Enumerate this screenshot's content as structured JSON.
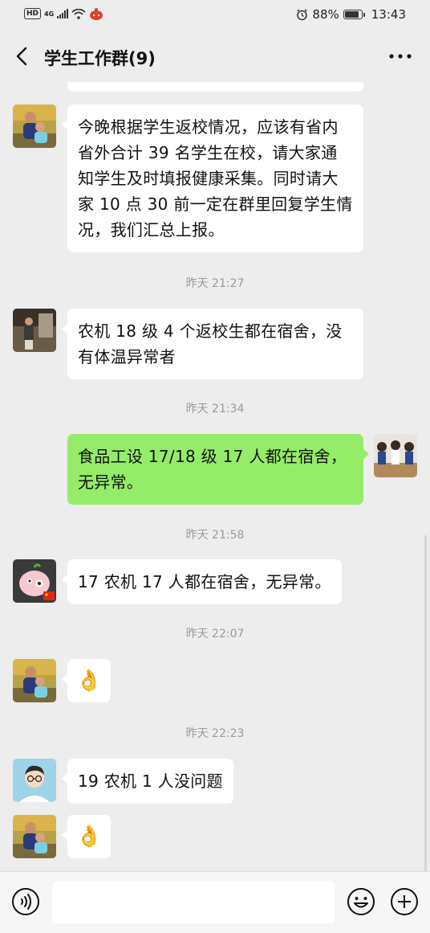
{
  "status_bar": {
    "hd": "HD",
    "network": "4G",
    "battery_percent": "88%",
    "battery_level": 0.88,
    "time": "13:43"
  },
  "nav": {
    "title": "学生工作群(9)"
  },
  "messages": [
    {
      "side": "left",
      "avatar": "avatar-child-photo",
      "text": "今晚根据学生返校情况，应该有省内省外合计 39 名学生在校，请大家通知学生及时填报健康采集。同时请大家 10 点 30 前一定在群里回复学生情况，我们汇总上报。"
    },
    {
      "type": "time",
      "text": "昨天 21:27"
    },
    {
      "side": "left",
      "avatar": "avatar-person-photo",
      "text": "农机 18 级 4 个返校生都在宿舍，没有体温异常者"
    },
    {
      "type": "time",
      "text": "昨天 21:34"
    },
    {
      "side": "right",
      "avatar": "avatar-figurines-photo",
      "text": "食品工设 17/18 级 17 人都在宿舍，无异常。"
    },
    {
      "type": "time",
      "text": "昨天 21:58"
    },
    {
      "side": "left",
      "avatar": "avatar-cartoon-pig",
      "text": "17 农机 17 人都在宿舍，无异常。"
    },
    {
      "type": "time",
      "text": "昨天 22:07"
    },
    {
      "side": "left",
      "avatar": "avatar-child-photo",
      "emoji": "👌"
    },
    {
      "type": "time",
      "text": "昨天 22:23"
    },
    {
      "side": "left",
      "avatar": "avatar-cartoon-man",
      "text": "19 农机 1 人没问题"
    },
    {
      "side": "left",
      "avatar": "avatar-child-photo",
      "emoji": "👌"
    }
  ],
  "input": {
    "value": "",
    "placeholder": ""
  },
  "colors": {
    "background": "#ededed",
    "bubble_self": "#95ec69",
    "bubble_other": "#ffffff",
    "timestamp": "#9a9a9a"
  }
}
